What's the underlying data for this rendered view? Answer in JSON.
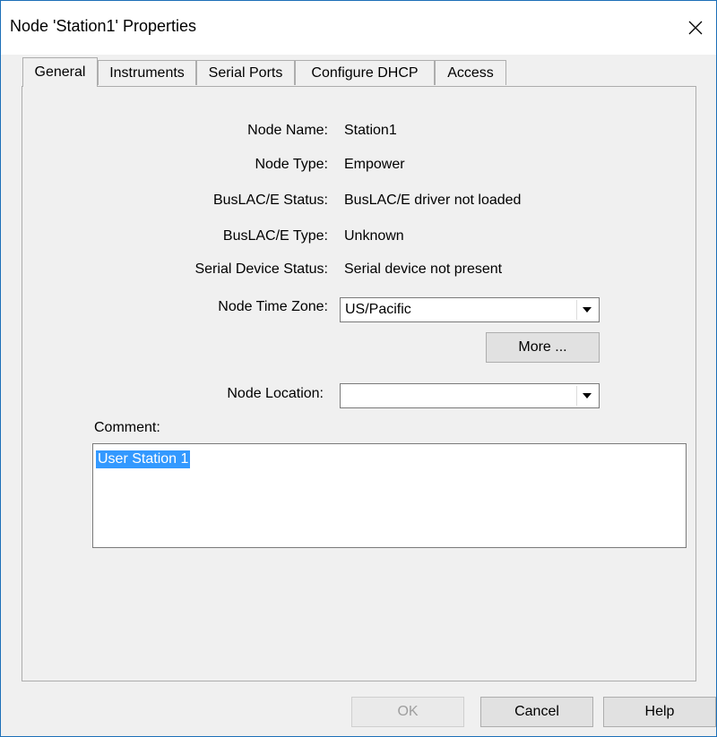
{
  "window": {
    "title": "Node 'Station1' Properties"
  },
  "tabs": [
    {
      "label": "General",
      "active": true
    },
    {
      "label": "Instruments",
      "active": false
    },
    {
      "label": "Serial Ports",
      "active": false
    },
    {
      "label": "Configure DHCP",
      "active": false
    },
    {
      "label": "Access",
      "active": false
    }
  ],
  "fields": {
    "node_name_label": "Node Name:",
    "node_name_value": "Station1",
    "node_type_label": "Node Type:",
    "node_type_value": "Empower",
    "buslac_status_label": "BusLAC/E Status:",
    "buslac_status_value": "BusLAC/E driver not loaded",
    "buslac_type_label": "BusLAC/E Type:",
    "buslac_type_value": "Unknown",
    "serial_status_label": "Serial Device Status:",
    "serial_status_value": "Serial device not present",
    "time_zone_label": "Node Time Zone:",
    "time_zone_value": "US/Pacific",
    "more_button": "More ...",
    "location_label": "Node Location:",
    "location_value": "",
    "comment_label": "Comment:",
    "comment_value": "User Station 1"
  },
  "buttons": {
    "ok": "OK",
    "cancel": "Cancel",
    "help": "Help"
  },
  "icons": {
    "close": "close-icon",
    "dropdown": "chevron-down-icon"
  },
  "colors": {
    "selection": "#3399ff",
    "window_border": "#1c6fb8",
    "face": "#f0f0f0"
  }
}
